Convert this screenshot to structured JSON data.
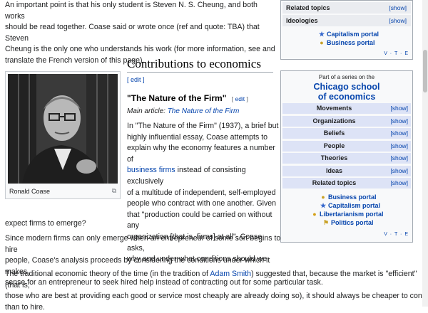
{
  "intro_lines": [
    "An important point is that his only student is Steven N. S. Cheung, and both works",
    "should be read together. Coase said or wrote once (ref and quote: TBA) that Steven",
    "Cheung is the only one who understands his work (for more information, see and",
    "translate the French version of this page)."
  ],
  "section": {
    "title": "Contributions to economics",
    "edit": "[ edit ]"
  },
  "figure": {
    "caption": "Ronald Coase",
    "magnify": "⧉"
  },
  "subsection": {
    "title": "\"The Nature of the Firm\"",
    "edit_open": "[ ",
    "edit_word": "edit",
    "edit_close": " ]",
    "main_article_prefix": "Main article: ",
    "main_article_link": "The Nature of the Firm"
  },
  "firm_paragraph": {
    "line1": "In \"The Nature of the Firm\" (1937), a brief but",
    "line2": "highly influential essay, Coase attempts to",
    "line3": "explain why the economy features a number of",
    "line4_link": "business firms",
    "line4_rest": " instead of consisting exclusively",
    "line5": "of a multitude of independent, self-employed",
    "line6": "people who contract with one another. Given",
    "line7": "that \"production could be carried on without any",
    "line8": "organization [that is, firms] at all\", Coase asks,",
    "line9": "why and under what conditions should we",
    "line10": "expect firms to emerge?"
  },
  "para2": [
    "Since modern firms can only emerge when an entrepreneur of some sort begins to hire",
    "people, Coase's analysis proceeds by considering the conditions under which it makes",
    "sense for an entrepreneur to seek hired help instead of contracting out for some particular task."
  ],
  "para3": {
    "line1_pre": "The traditional economic theory of the time (in the tradition of ",
    "line1_link": "Adam Smith",
    "line1_post": ") suggested that, because the market is \"efficient\" (that is,",
    "line2": "those who are best at providing each good or service most cheaply are already doing so), it should always be cheaper to contract out",
    "line3": "than to hire."
  },
  "navbox_top": {
    "rows": [
      {
        "label": "Related topics",
        "show": "[show]"
      },
      {
        "label": "Ideologies",
        "show": "[show]"
      }
    ],
    "portals": [
      {
        "icon": "star-icon",
        "glyph": "★",
        "color": "#3366cc",
        "label": "Capitalism portal"
      },
      {
        "icon": "coins-icon",
        "glyph": "●",
        "color": "#c9a227",
        "label": "Business portal"
      }
    ],
    "vte": "V · T · E"
  },
  "navbox_series": {
    "pre": "Part of a series on the",
    "title_line1": "Chicago school",
    "title_line2": "of economics",
    "rows": [
      {
        "label": "Movements",
        "show": "[show]"
      },
      {
        "label": "Organizations",
        "show": "[show]"
      },
      {
        "label": "Beliefs",
        "show": "[show]"
      },
      {
        "label": "People",
        "show": "[show]"
      },
      {
        "label": "Theories",
        "show": "[show]"
      },
      {
        "label": "Ideas",
        "show": "[show]"
      },
      {
        "label": "Related topics",
        "show": "[show]"
      }
    ],
    "portals": [
      {
        "icon": "coins-icon",
        "glyph": "●",
        "color": "#c9a227",
        "label": "Business portal"
      },
      {
        "icon": "star-icon",
        "glyph": "★",
        "color": "#3366cc",
        "label": "Capitalism portal"
      },
      {
        "icon": "torch-icon",
        "glyph": "●",
        "color": "#d4a017",
        "label": "Libertarianism portal"
      },
      {
        "icon": "flag-icon",
        "glyph": "⚑",
        "color": "#c9a227",
        "label": "Politics portal"
      }
    ],
    "vte": "V · T · E"
  }
}
